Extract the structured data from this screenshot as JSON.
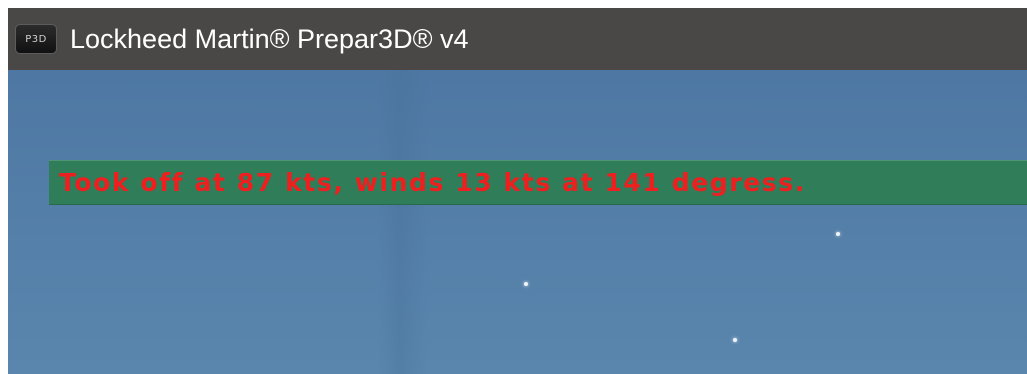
{
  "window": {
    "icon": "p3d-app-icon",
    "icon_text": "P3D",
    "title": "Lockheed Martin® Prepar3D® v4"
  },
  "simulator": {
    "message": "Took off at 87 kts, winds 13 kts at 141 degress.",
    "message_color": "#ee1f1f",
    "message_bar_color": "#2f7d59",
    "sky_color": "#537ea8"
  }
}
